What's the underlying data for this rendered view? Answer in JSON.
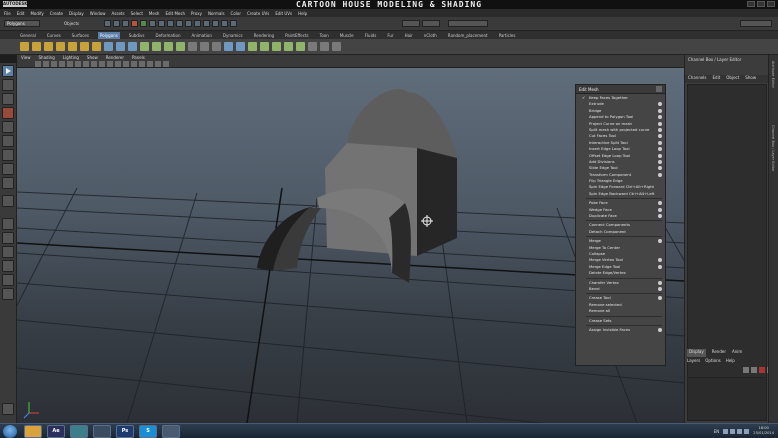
{
  "titlebar": {
    "logo_text": "AUTODESK",
    "video_title": "CARTOON HOUSE MODELING & SHADING"
  },
  "menubar": [
    "File",
    "Edit",
    "Modify",
    "Create",
    "Display",
    "Window",
    "Assets",
    "Select",
    "Mesh",
    "Edit Mesh",
    "Proxy",
    "Normals",
    "Color",
    "Create UVs",
    "Edit UVs",
    "Help"
  ],
  "statusline": {
    "mode": "Polygons",
    "selection_mode": "Objects"
  },
  "shelf_tabs": [
    {
      "label": "General",
      "active": false
    },
    {
      "label": "Curves",
      "active": false
    },
    {
      "label": "Surfaces",
      "active": false
    },
    {
      "label": "Polygons",
      "active": true
    },
    {
      "label": "Subdivs",
      "active": false
    },
    {
      "label": "Deformation",
      "active": false
    },
    {
      "label": "Animation",
      "active": false
    },
    {
      "label": "Dynamics",
      "active": false
    },
    {
      "label": "Rendering",
      "active": false
    },
    {
      "label": "PaintEffects",
      "active": false
    },
    {
      "label": "Toon",
      "active": false
    },
    {
      "label": "Muscle",
      "active": false
    },
    {
      "label": "Fluids",
      "active": false
    },
    {
      "label": "Fur",
      "active": false
    },
    {
      "label": "Hair",
      "active": false
    },
    {
      "label": "nCloth",
      "active": false
    },
    {
      "label": "Random_placement",
      "active": false
    },
    {
      "label": "Particles",
      "active": false
    }
  ],
  "panel_menus": [
    "View",
    "Shading",
    "Lighting",
    "Show",
    "Renderer",
    "Panels"
  ],
  "edit_mesh_menu": {
    "title": "Edit Mesh",
    "items": [
      {
        "label": "Keep Faces Together",
        "checked": true,
        "option": false,
        "sep_after": false
      },
      {
        "label": "Extrude",
        "checked": false,
        "option": true,
        "sep_after": false
      },
      {
        "label": "Bridge",
        "checked": false,
        "option": true,
        "sep_after": false
      },
      {
        "label": "Append to Polygon Tool",
        "checked": false,
        "option": true,
        "sep_after": false
      },
      {
        "label": "Project Curve on mesh",
        "checked": false,
        "option": true,
        "sep_after": false
      },
      {
        "label": "Split mesh with projected curve",
        "checked": false,
        "option": true,
        "sep_after": false
      },
      {
        "label": "Cut Faces Tool",
        "checked": false,
        "option": true,
        "sep_after": false
      },
      {
        "label": "Interactive Split Tool",
        "checked": false,
        "option": true,
        "sep_after": false
      },
      {
        "label": "Insert Edge Loop Tool",
        "checked": false,
        "option": true,
        "sep_after": false
      },
      {
        "label": "Offset Edge Loop Tool",
        "checked": false,
        "option": true,
        "sep_after": false
      },
      {
        "label": "Add Divisions",
        "checked": false,
        "option": true,
        "sep_after": false
      },
      {
        "label": "Slide Edge Tool",
        "checked": false,
        "option": true,
        "sep_after": false
      },
      {
        "label": "Transform Component",
        "checked": false,
        "option": true,
        "sep_after": false
      },
      {
        "label": "Flip Triangle Edge",
        "checked": false,
        "option": false,
        "sep_after": false
      },
      {
        "label": "Spin Edge Forward  Ctrl+Alt+Right",
        "checked": false,
        "option": false,
        "sep_after": false
      },
      {
        "label": "Spin Edge Backward  Ctrl+Alt+Left",
        "checked": false,
        "option": false,
        "sep_after": true
      },
      {
        "label": "Poke Face",
        "checked": false,
        "option": true,
        "sep_after": false
      },
      {
        "label": "Wedge Face",
        "checked": false,
        "option": true,
        "sep_after": false
      },
      {
        "label": "Duplicate Face",
        "checked": false,
        "option": true,
        "sep_after": true
      },
      {
        "label": "Connect Components",
        "checked": false,
        "option": false,
        "sep_after": false
      },
      {
        "label": "Detach Component",
        "checked": false,
        "option": false,
        "sep_after": true
      },
      {
        "label": "Merge",
        "checked": false,
        "option": true,
        "sep_after": false
      },
      {
        "label": "Merge To Center",
        "checked": false,
        "option": false,
        "sep_after": false
      },
      {
        "label": "Collapse",
        "checked": false,
        "option": false,
        "sep_after": false
      },
      {
        "label": "Merge Vertex Tool",
        "checked": false,
        "option": true,
        "sep_after": false
      },
      {
        "label": "Merge Edge Tool",
        "checked": false,
        "option": true,
        "sep_after": false
      },
      {
        "label": "Delete Edge/Vertex",
        "checked": false,
        "option": false,
        "sep_after": true
      },
      {
        "label": "Chamfer Vertex",
        "checked": false,
        "option": true,
        "sep_after": false
      },
      {
        "label": "Bevel",
        "checked": false,
        "option": true,
        "sep_after": true
      },
      {
        "label": "Crease Tool",
        "checked": false,
        "option": true,
        "sep_after": false
      },
      {
        "label": "Remove selected",
        "checked": false,
        "option": false,
        "sep_after": false
      },
      {
        "label": "Remove all",
        "checked": false,
        "option": false,
        "sep_after": true
      },
      {
        "label": "Crease Sets",
        "checked": false,
        "option": false,
        "sep_after": true
      },
      {
        "label": "Assign Invisible Faces",
        "checked": false,
        "option": true,
        "sep_after": false
      }
    ]
  },
  "channel_box": {
    "header": "Channel Box / Layer Editor",
    "menus": [
      "Channels",
      "Edit",
      "Object",
      "Show"
    ]
  },
  "layer_editor": {
    "tabs": [
      {
        "label": "Display",
        "active": true
      },
      {
        "label": "Render",
        "active": false
      },
      {
        "label": "Anim",
        "active": false
      }
    ],
    "menus": [
      "Layers",
      "Options",
      "Help"
    ]
  },
  "side_tabs": [
    "Attribute Editor",
    "Channel Box / Layer Editor"
  ],
  "taskbar": {
    "apps": [
      {
        "name": "chrome-icon",
        "label": "",
        "color": "#d9a23a"
      },
      {
        "name": "after-effects-icon",
        "label": "Ae",
        "color": "#2a2f5e"
      },
      {
        "name": "maya-icon",
        "label": "",
        "color": "#3c7f8a"
      },
      {
        "name": "media-player-icon",
        "label": "",
        "color": "#3c4c60"
      },
      {
        "name": "photoshop-icon",
        "label": "Ps",
        "color": "#1e3a6e"
      },
      {
        "name": "skype-icon",
        "label": "S",
        "color": "#1a8fd6"
      },
      {
        "name": "window-icon",
        "label": "",
        "color": "#4a5a70"
      }
    ],
    "language": "EN",
    "time": "18:00",
    "date": "25/01/2014"
  },
  "colors": {
    "accent": "#5b7fa6",
    "viewport_top": "#606d7a",
    "viewport_bottom": "#2c3036",
    "mesh_light": "#6e6e6e",
    "mesh_dark": "#262626"
  }
}
